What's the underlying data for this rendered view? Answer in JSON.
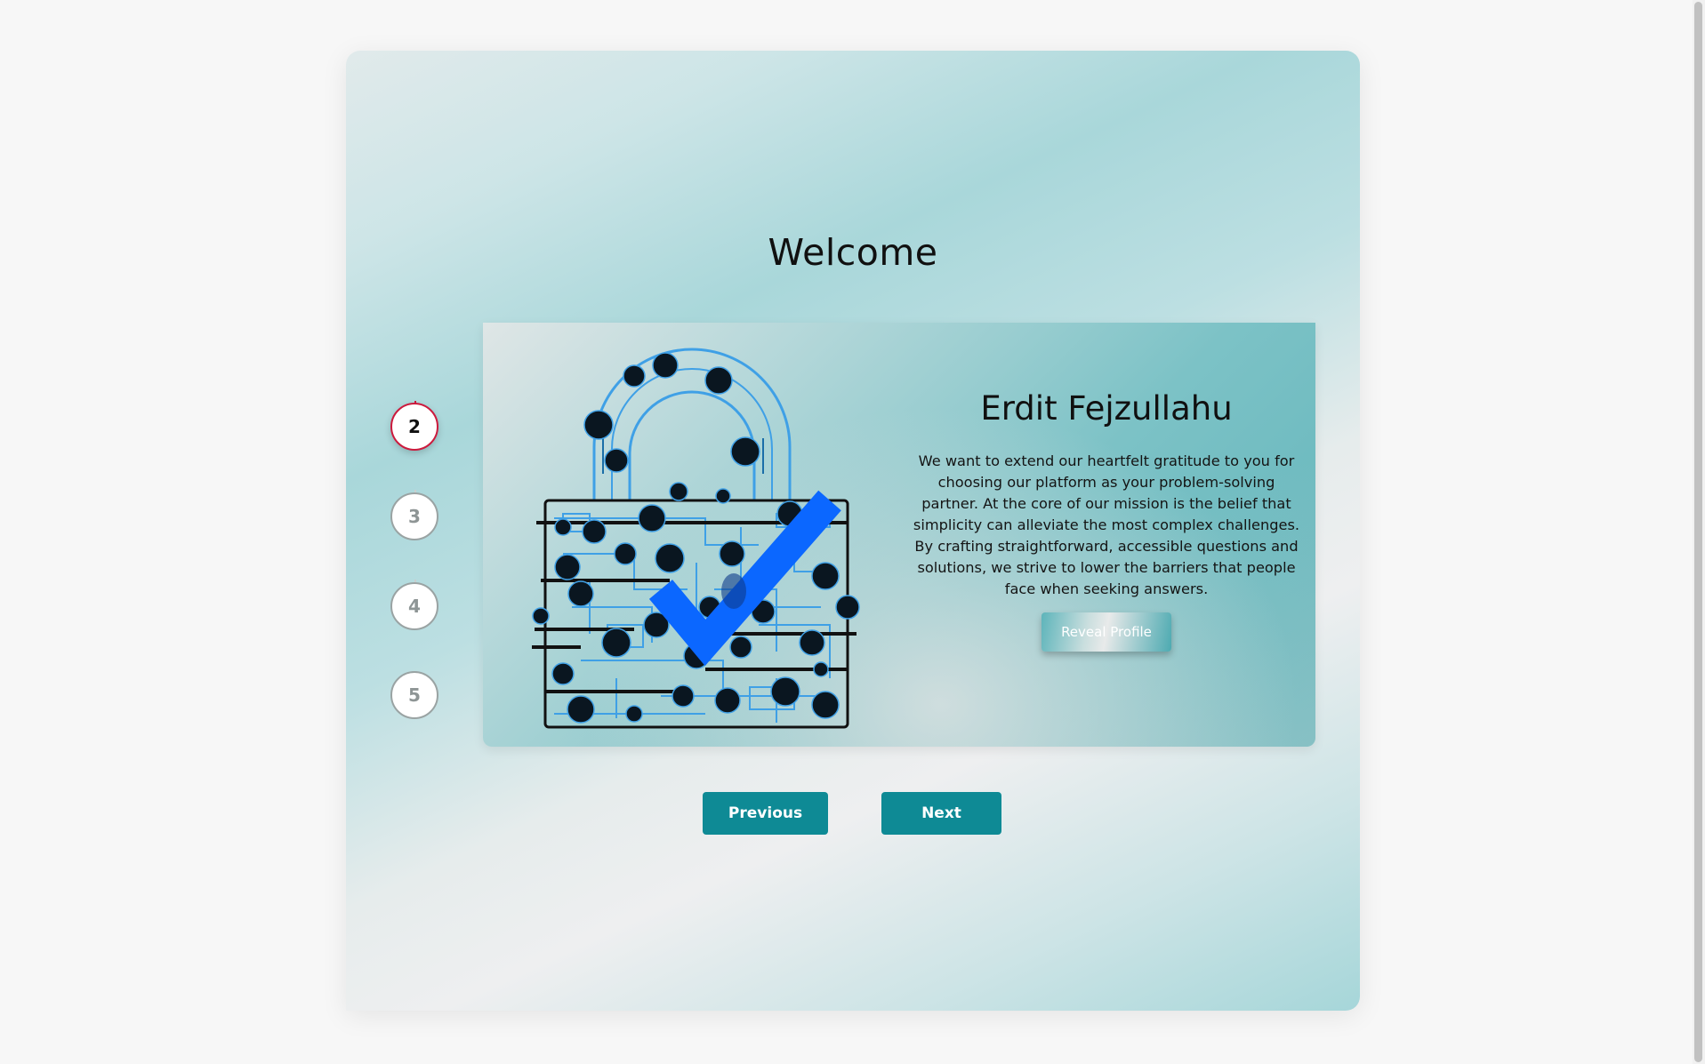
{
  "page": {
    "title": "Welcome"
  },
  "stepper": {
    "steps": [
      {
        "label": "2",
        "state": "active"
      },
      {
        "label": "3",
        "state": "inactive"
      },
      {
        "label": "4",
        "state": "inactive"
      },
      {
        "label": "5",
        "state": "inactive"
      }
    ],
    "active_color": "#cc1a3d",
    "inactive_color": "#9aa3a3"
  },
  "card": {
    "image": "padlock-circuit-checkmark-illustration",
    "name": "Erdit Fejzullahu",
    "description": "We want to extend our heartfelt gratitude to you for choosing our platform as your problem-solving partner. At the core of our mission is the belief that simplicity can alleviate the most complex challenges. By crafting straightforward, accessible questions and solutions, we strive to lower the barriers that people face when seeking answers.",
    "reveal_label": "Reveal Profile"
  },
  "navigation": {
    "previous_label": "Previous",
    "next_label": "Next",
    "button_color": "#0e8a95"
  }
}
